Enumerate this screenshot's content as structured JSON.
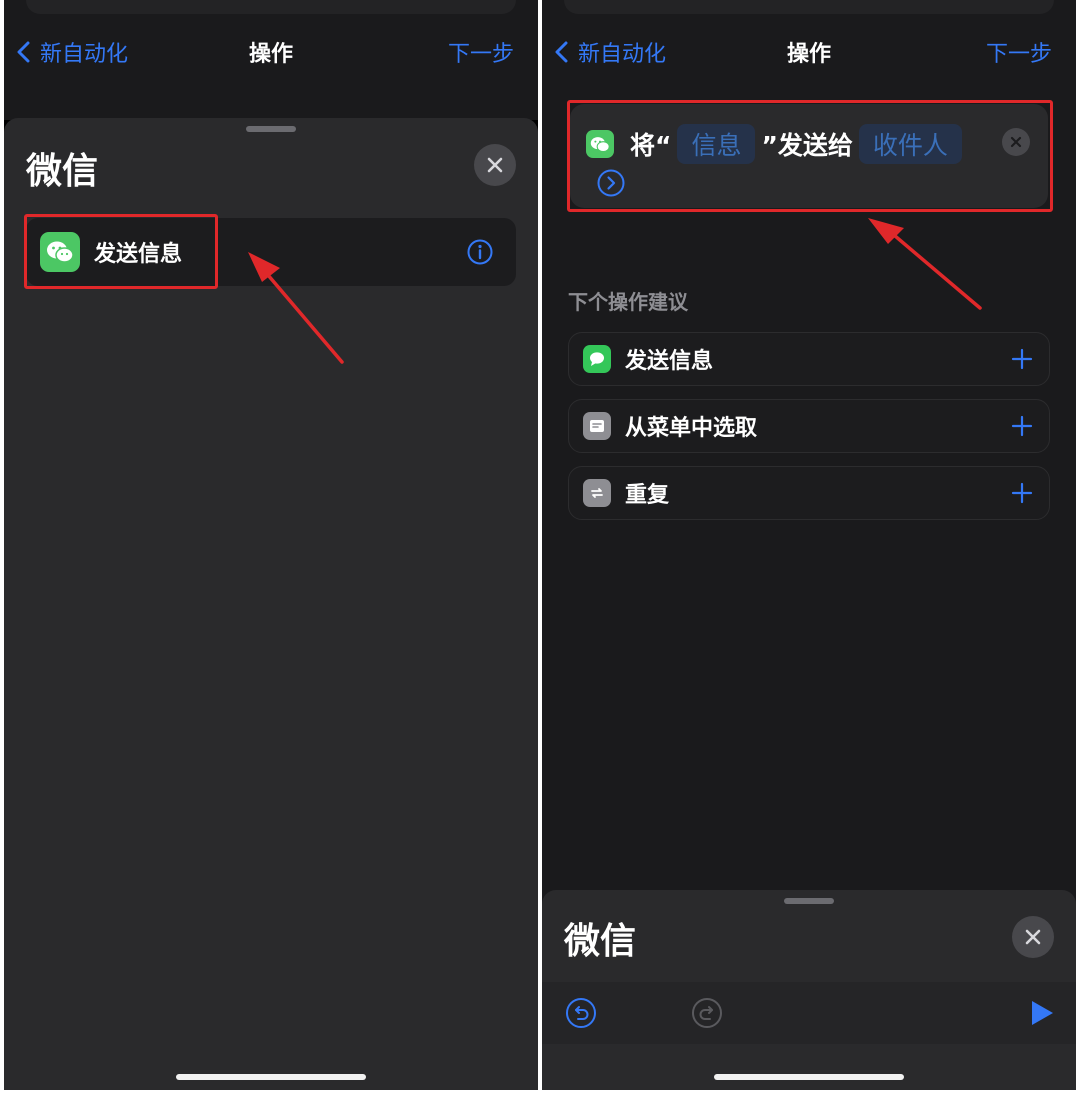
{
  "left": {
    "nav": {
      "back_label": "新自动化",
      "title": "操作",
      "next_label": "下一步"
    },
    "sheet": {
      "title": "微信",
      "action": {
        "label": "发送信息",
        "icon": "wechat-icon"
      }
    }
  },
  "right": {
    "nav": {
      "back_label": "新自动化",
      "title": "操作",
      "next_label": "下一步"
    },
    "action_card": {
      "prefix": "将“",
      "message_token": "信息",
      "middle": "”发送给",
      "recipient_token": "收件人"
    },
    "suggestions": {
      "header": "下个操作建议",
      "items": [
        {
          "label": "发送信息",
          "icon": "messages-icon",
          "color": "#34c759"
        },
        {
          "label": "从菜单中选取",
          "icon": "menu-icon",
          "color": "#8e8e93"
        },
        {
          "label": "重复",
          "icon": "repeat-icon",
          "color": "#8e8e93"
        }
      ]
    },
    "bottom_sheet": {
      "title": "微信"
    }
  },
  "colors": {
    "accent": "#3478f6",
    "highlight": "#e0282a",
    "wechat_green": "#4cc764"
  }
}
